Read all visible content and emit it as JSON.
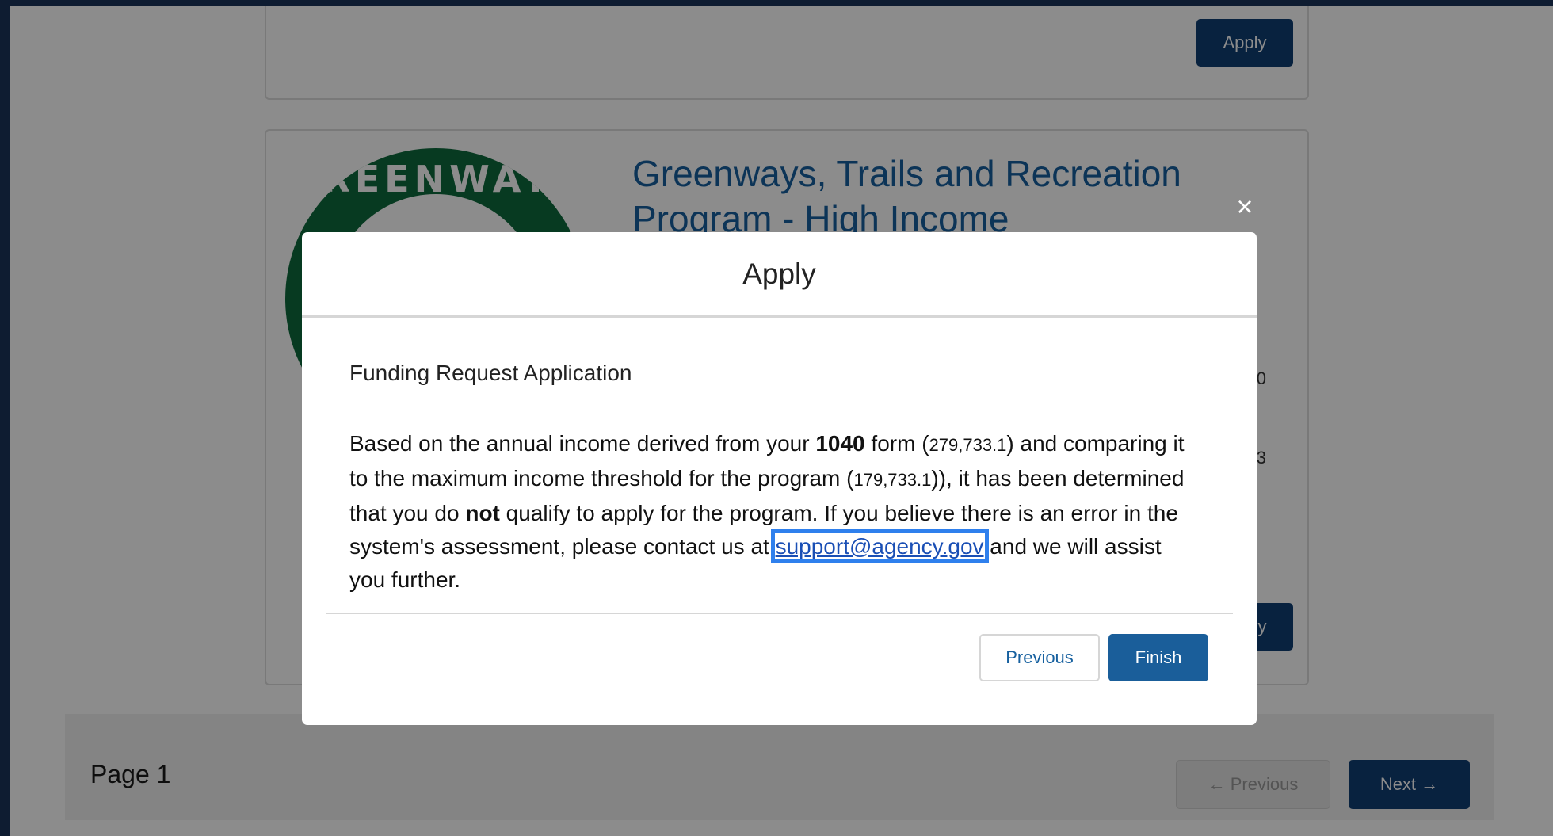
{
  "background": {
    "top_card": {
      "apply_label": "Apply"
    },
    "program_card": {
      "logo_text": "GREENWAYS",
      "title": "Greenways, Trails and Recreation Program - High Income",
      "apply_label": "Apply",
      "peek_digit_1": "0",
      "peek_digit_2": "3"
    },
    "pager": {
      "page_label": "Page 1",
      "prev_label": "← Previous",
      "next_label": "Next →"
    }
  },
  "modal": {
    "close_label": "×",
    "title": "Apply",
    "subtitle": "Funding Request Application",
    "text_1": "Based on the annual income derived from your ",
    "bold_1": "1040",
    "text_2": " form (",
    "income_value": "279,733.1",
    "text_3": ") and comparing it to the maximum income threshold for the program (",
    "threshold_value": "179,733.1",
    "text_4": ")), it has been determined that you do ",
    "bold_2": "not",
    "text_5": " qualify to apply for the program. If you believe there is an error in the system's assessment, please contact us at ",
    "email": "support@agency.gov",
    "text_6": " and we will assist you further.",
    "previous_label": "Previous",
    "finish_label": "Finish"
  },
  "colors": {
    "navy": "#0f3f73",
    "link_blue": "#16609f",
    "focus_outline": "#2f80ed",
    "logo_green": "#0e6a3c"
  }
}
